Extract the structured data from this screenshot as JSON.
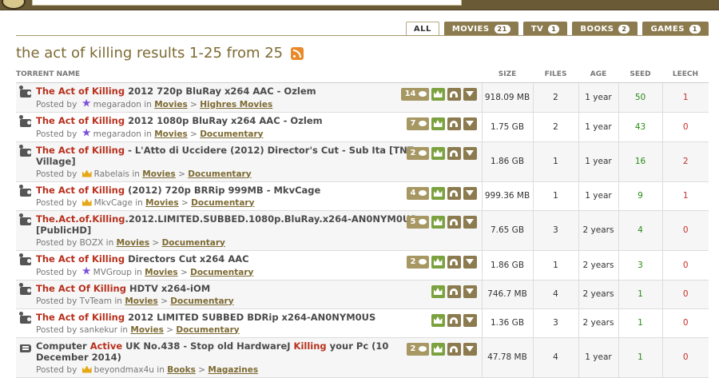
{
  "tabs": [
    {
      "label": "ALL",
      "badge": ""
    },
    {
      "label": "MOVIES",
      "badge": "21"
    },
    {
      "label": "TV",
      "badge": "1"
    },
    {
      "label": "BOOKS",
      "badge": "2"
    },
    {
      "label": "GAMES",
      "badge": "1"
    }
  ],
  "title": "the act of killing results 1-25 from 25",
  "columns": {
    "name": "TORRENT NAME",
    "size": "SIZE",
    "files": "FILES",
    "age": "AGE",
    "seed": "SEED",
    "leech": "LEECH"
  },
  "posted_by_label": "Posted by",
  "in_label": "in",
  "rows": [
    {
      "icon": "film",
      "hl": "The Act of Killing",
      "rest": " 2012 720p BluRay x264 AAC - Ozlem",
      "user": "megaradon",
      "rank": "star",
      "cat": "Movies",
      "sub": "Highres Movies",
      "comments": "14",
      "size": "918.09 MB",
      "files": "2",
      "age": "1 year",
      "seed": "50",
      "leech": "1"
    },
    {
      "icon": "film",
      "hl": "The Act of Killing",
      "rest": " 2012 1080p BluRay x264 AAC - Ozlem",
      "user": "megaradon",
      "rank": "star",
      "cat": "Movies",
      "sub": "Documentary",
      "comments": "7",
      "size": "1.75 GB",
      "files": "2",
      "age": "1 year",
      "seed": "43",
      "leech": "0"
    },
    {
      "icon": "film",
      "hl": "The Act of Killing",
      "rest": " - L'Atto di Uccidere (2012) Director's Cut - Sub Ita [TNT Village]",
      "user": "Rabelais",
      "rank": "crown",
      "cat": "Movies",
      "sub": "Documentary",
      "comments": "2",
      "size": "1.86 GB",
      "files": "1",
      "age": "1 year",
      "seed": "16",
      "leech": "2"
    },
    {
      "icon": "film",
      "hl": "The Act of Killing",
      "rest": " (2012) 720p BRRip 999MB - MkvCage",
      "user": "MkvCage",
      "rank": "crown",
      "cat": "Movies",
      "sub": "Documentary",
      "comments": "4",
      "size": "999.36 MB",
      "files": "1",
      "age": "1 year",
      "seed": "9",
      "leech": "1"
    },
    {
      "icon": "film",
      "hl": "The.Act.of.Killing",
      "rest": ".2012.LIMITED.SUBBED.1080p.BluRay.x264-AN0NYM0US [PublicHD]",
      "user": "BOZX",
      "rank": "",
      "cat": "Movies",
      "sub": "Documentary",
      "comments": "5",
      "size": "7.65 GB",
      "files": "3",
      "age": "2 years",
      "seed": "4",
      "leech": "0"
    },
    {
      "icon": "film",
      "hl": "The Act of Killing",
      "rest": " Directors Cut x264 AAC",
      "user": "MVGroup",
      "rank": "star",
      "cat": "Movies",
      "sub": "Documentary",
      "comments": "2",
      "size": "1.86 GB",
      "files": "1",
      "age": "2 years",
      "seed": "3",
      "leech": "0"
    },
    {
      "icon": "film",
      "hl": "The Act Of Killing",
      "rest": " HDTV x264-iOM",
      "user": "TvTeam",
      "rank": "",
      "cat": "Movies",
      "sub": "Documentary",
      "comments": "",
      "size": "746.7 MB",
      "files": "4",
      "age": "2 years",
      "seed": "1",
      "leech": "0"
    },
    {
      "icon": "film",
      "hl": "The Act of Killing",
      "rest": " 2012 LIMITED SUBBED BDRip x264-AN0NYM0US",
      "user": "sankekur",
      "rank": "",
      "cat": "Movies",
      "sub": "Documentary",
      "comments": "",
      "size": "1.36 GB",
      "files": "3",
      "age": "2 years",
      "seed": "1",
      "leech": "0"
    },
    {
      "icon": "book",
      "hl": "",
      "rest": "",
      "segments": [
        "Computer ",
        "Active",
        " UK No.438 - Stop old HardwareJ ",
        "Killing",
        " your Pc (10 December 2014)"
      ],
      "user": "beyondmax4u",
      "rank": "crown",
      "cat": "Books",
      "sub": "Magazines",
      "comments": "2",
      "size": "47.78 MB",
      "files": "4",
      "age": "1 year",
      "seed": "1",
      "leech": "0"
    }
  ]
}
